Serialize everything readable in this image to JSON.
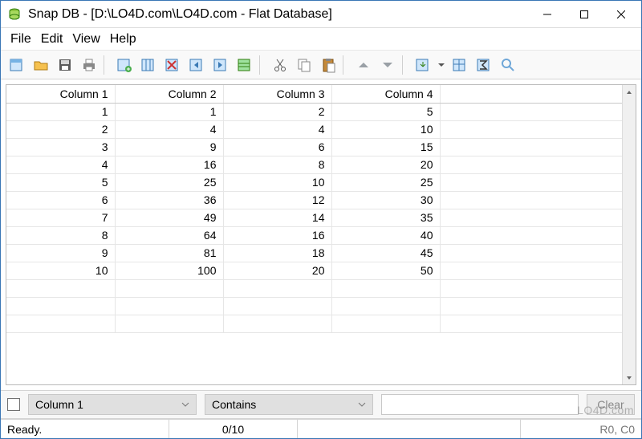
{
  "window": {
    "title": "Snap DB - [D:\\LO4D.com\\LO4D.com - Flat Database]"
  },
  "menu": {
    "file": "File",
    "edit": "Edit",
    "view": "View",
    "help": "Help"
  },
  "toolbar": {
    "icons": {
      "new": "new-db-icon",
      "open": "open-icon",
      "save": "save-icon",
      "print": "print-icon",
      "addcol": "add-column-icon",
      "editcol": "edit-column-icon",
      "delcol": "delete-column-icon",
      "moveleft": "move-left-icon",
      "moveright": "move-right-icon",
      "insert": "insert-row-icon",
      "cut": "cut-icon",
      "copy": "copy-icon",
      "paste": "paste-icon",
      "up": "up-icon",
      "down": "down-icon",
      "export": "export-icon",
      "caret": "dropdown-caret-icon",
      "calc": "calculate-icon",
      "sum": "sum-icon",
      "search": "search-icon"
    }
  },
  "grid": {
    "headers": [
      "Column 1",
      "Column 2",
      "Column 3",
      "Column 4"
    ],
    "rows": [
      [
        "1",
        "1",
        "2",
        "5"
      ],
      [
        "2",
        "4",
        "4",
        "10"
      ],
      [
        "3",
        "9",
        "6",
        "15"
      ],
      [
        "4",
        "16",
        "8",
        "20"
      ],
      [
        "5",
        "25",
        "10",
        "25"
      ],
      [
        "6",
        "36",
        "12",
        "30"
      ],
      [
        "7",
        "49",
        "14",
        "35"
      ],
      [
        "8",
        "64",
        "16",
        "40"
      ],
      [
        "9",
        "81",
        "18",
        "45"
      ],
      [
        "10",
        "100",
        "20",
        "50"
      ]
    ]
  },
  "filter": {
    "column": "Column 1",
    "op": "Contains",
    "value": "",
    "clear": "Clear"
  },
  "status": {
    "ready": "Ready.",
    "count": "0/10",
    "pos": "R0, C0"
  },
  "watermark": "LO4D.com"
}
